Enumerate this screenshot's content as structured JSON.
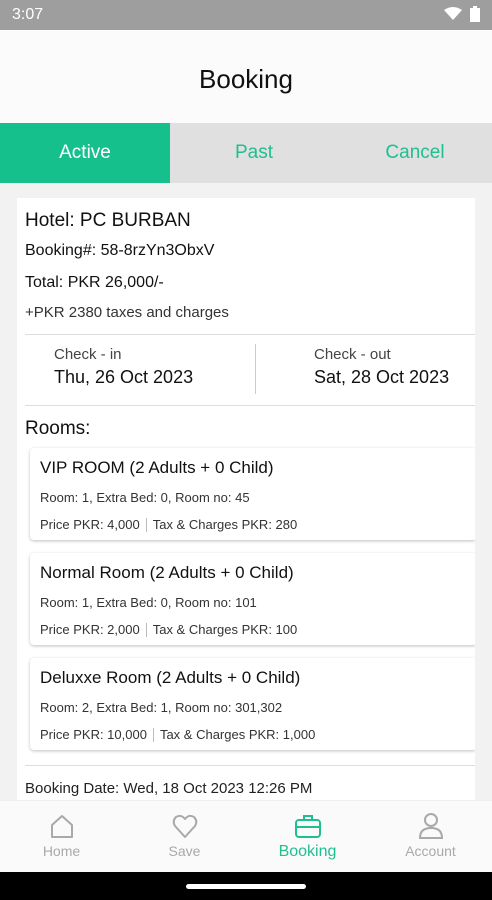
{
  "status": {
    "time": "3:07"
  },
  "app": {
    "title": "Booking"
  },
  "tabs": [
    {
      "label": "Active",
      "active": true
    },
    {
      "label": "Past",
      "active": false
    },
    {
      "label": "Cancel",
      "active": false
    }
  ],
  "booking": {
    "hotel": "Hotel: PC BURBAN",
    "booking_no": "Booking#: 58-8rzYn3ObxV",
    "total": "Total: PKR 26,000/-",
    "taxes": "+PKR 2380 taxes and charges",
    "checkin_label": "Check - in",
    "checkin_value": "Thu, 26 Oct 2023",
    "checkout_label": "Check - out",
    "checkout_value": "Sat, 28 Oct 2023",
    "rooms_label": "Rooms:",
    "rooms": [
      {
        "title": "VIP ROOM (2 Adults + 0 Child)",
        "details": "Room: 1, Extra Bed: 0, Room no: 45",
        "price": "Price PKR: 4,000",
        "tax": "Tax & Charges PKR: 280"
      },
      {
        "title": "Normal Room (2 Adults + 0 Child)",
        "details": "Room: 1, Extra Bed: 0, Room no: 101",
        "price": "Price PKR: 2,000",
        "tax": "Tax & Charges PKR: 100"
      },
      {
        "title": "Deluxxe Room (2 Adults + 0 Child)",
        "details": "Room: 2, Extra Bed: 1, Room no: 301,302",
        "price": "Price PKR: 10,000",
        "tax": "Tax & Charges PKR: 1,000"
      }
    ],
    "booking_date": "Booking Date: Wed, 18 Oct 2023 12:26 PM"
  },
  "nav": [
    {
      "label": "Home",
      "icon": "home-icon",
      "active": false
    },
    {
      "label": "Save",
      "icon": "heart-icon",
      "active": false
    },
    {
      "label": "Booking",
      "icon": "briefcase-icon",
      "active": true
    },
    {
      "label": "Account",
      "icon": "person-icon",
      "active": false
    }
  ],
  "colors": {
    "accent": "#16c08d",
    "tab_bg": "#e0e0e0",
    "inactive": "#a9a9a9"
  }
}
